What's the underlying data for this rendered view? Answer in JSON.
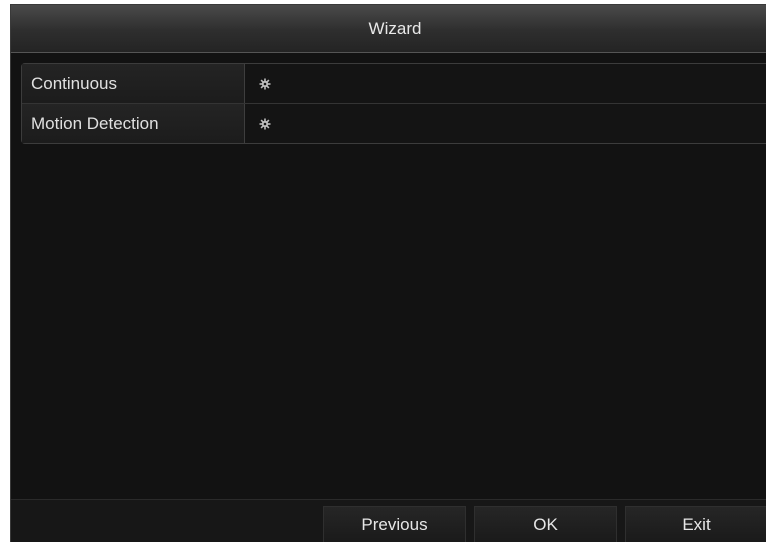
{
  "window": {
    "title": "Wizard"
  },
  "schedule_list": {
    "rows": [
      {
        "label": "Continuous",
        "action_icon": "gear-icon"
      },
      {
        "label": "Motion Detection",
        "action_icon": "gear-icon"
      }
    ]
  },
  "footer": {
    "previous_label": "Previous",
    "ok_label": "OK",
    "exit_label": "Exit"
  },
  "colors": {
    "background": "#121212",
    "titlebar": "#3a3a3a",
    "text": "#e0e0e0",
    "border": "#3c3c3c"
  }
}
